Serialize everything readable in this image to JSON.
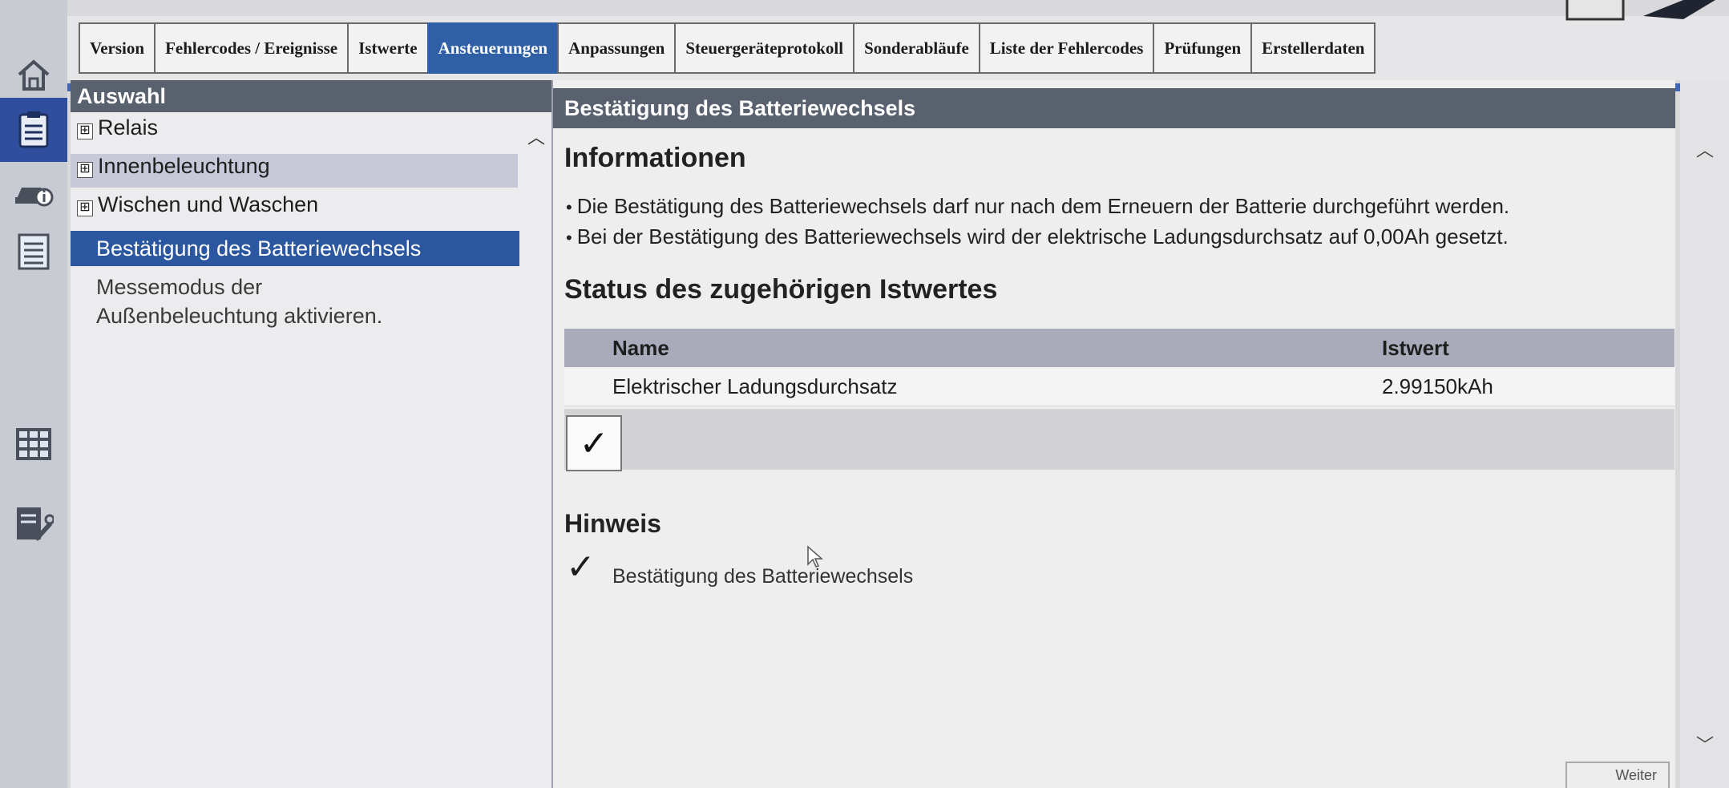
{
  "tabs": [
    {
      "label": "Version",
      "active": false
    },
    {
      "label": "Fehlercodes / Ereignisse",
      "active": false
    },
    {
      "label": "Istwerte",
      "active": false
    },
    {
      "label": "Ansteuerungen",
      "active": true
    },
    {
      "label": "Anpassungen",
      "active": false
    },
    {
      "label": "Steuergeräteprotokoll",
      "active": false
    },
    {
      "label": "Sonderabläufe",
      "active": false
    },
    {
      "label": "Liste der Fehlercodes",
      "active": false
    },
    {
      "label": "Prüfungen",
      "active": false
    },
    {
      "label": "Erstellerdaten",
      "active": false
    }
  ],
  "left": {
    "header": "Auswahl",
    "items": [
      {
        "label": "Relais",
        "expandable": true,
        "state": "normal"
      },
      {
        "label": "Innenbeleuchtung",
        "expandable": true,
        "state": "highlighted"
      },
      {
        "label": "Wischen und Waschen",
        "expandable": true,
        "state": "normal"
      },
      {
        "label": "Bestätigung des Batteriewechsels",
        "expandable": false,
        "state": "selected"
      },
      {
        "label": "Messemodus der Außenbeleuchtung aktivieren.",
        "expandable": false,
        "state": "normal"
      }
    ],
    "expand_symbol": "⊞"
  },
  "content": {
    "header": "Bestätigung des Batteriewechsels",
    "info_heading": "Informationen",
    "info_bullets": [
      "Die Bestätigung des Batteriewechsels darf nur nach dem Erneuern der Batterie durchgeführt werden.",
      "Bei der Bestätigung des Batteriewechsels wird der elektrische Ladungsdurchsatz auf 0,00Ah gesetzt."
    ],
    "status_heading": "Status des zugehörigen Istwertes",
    "table": {
      "headers": [
        "Name",
        "Istwert"
      ],
      "rows": [
        [
          "Elektrischer Ladungsdurchsatz",
          "2.99150kAh"
        ]
      ]
    },
    "confirm_symbol": "✓",
    "hint_heading": "Hinweis",
    "hint_symbol": "✓",
    "hint_text": "Bestätigung des Batteriewechsels"
  },
  "footer": {
    "next_label": "Weiter"
  },
  "rail_icons": [
    "home-icon",
    "clipboard-icon",
    "vehicle-info-icon",
    "list-icon",
    "grid-icon",
    "service-icon"
  ],
  "colors": {
    "accent": "#2e5fa7",
    "header_bg": "#59606e",
    "selected_bg": "#2b56a0"
  }
}
